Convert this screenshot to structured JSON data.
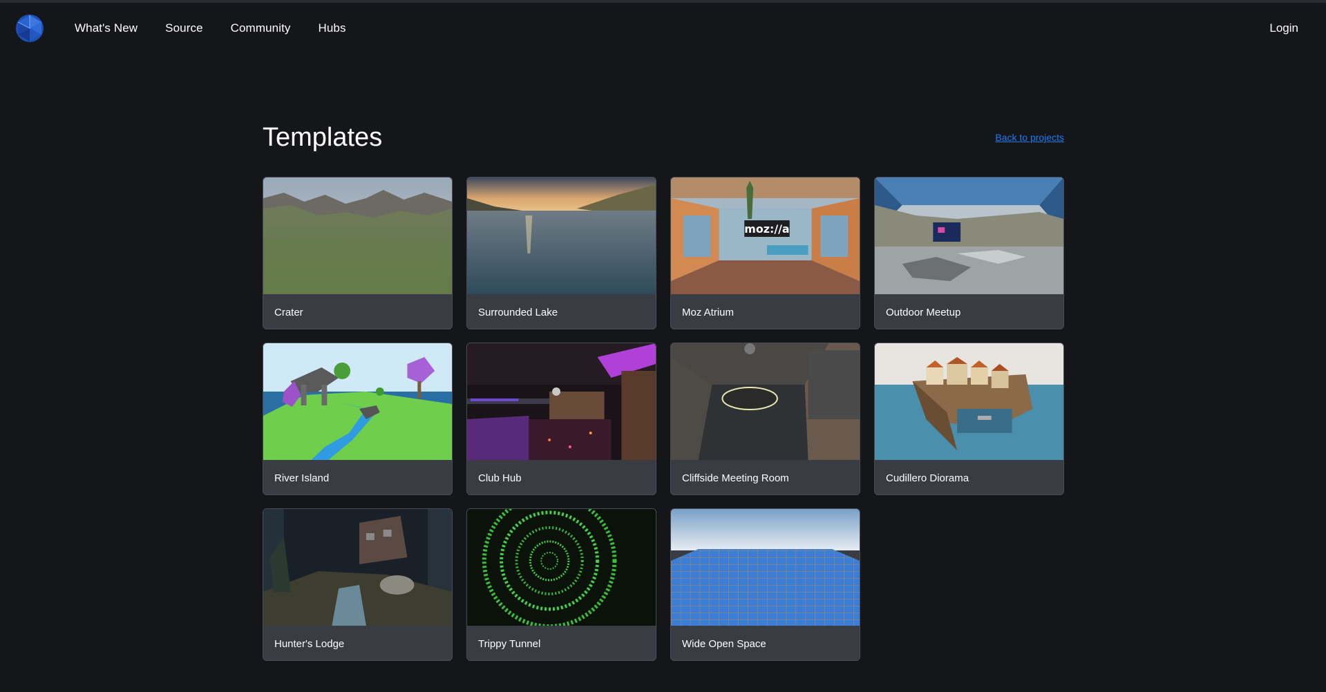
{
  "nav": {
    "logo_icon": "spoke-logo-icon",
    "links": [
      "What's New",
      "Source",
      "Community",
      "Hubs"
    ],
    "login": "Login"
  },
  "page": {
    "title": "Templates",
    "back_link": "Back to projects"
  },
  "templates": [
    {
      "name": "Crater",
      "thumb": "crater"
    },
    {
      "name": "Surrounded Lake",
      "thumb": "lake"
    },
    {
      "name": "Moz Atrium",
      "thumb": "atrium",
      "sign_text": "moz://a"
    },
    {
      "name": "Outdoor Meetup",
      "thumb": "meetup"
    },
    {
      "name": "River Island",
      "thumb": "island"
    },
    {
      "name": "Club Hub",
      "thumb": "club"
    },
    {
      "name": "Cliffside Meeting Room",
      "thumb": "cliffside"
    },
    {
      "name": "Cudillero Diorama",
      "thumb": "diorama"
    },
    {
      "name": "Hunter's Lodge",
      "thumb": "lodge"
    },
    {
      "name": "Trippy Tunnel",
      "thumb": "tunnel"
    },
    {
      "name": "Wide Open Space",
      "thumb": "space"
    }
  ],
  "colors": {
    "background": "#151619",
    "card": "#393c43",
    "link": "#1e7cf2"
  }
}
